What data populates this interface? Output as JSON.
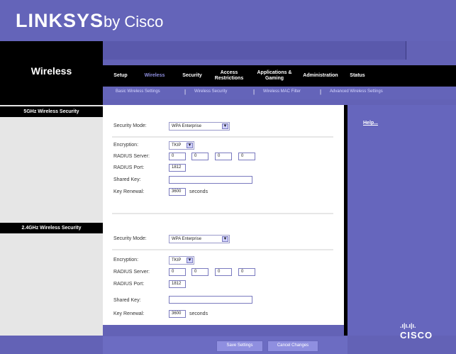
{
  "brand": {
    "name": "LINKSYS",
    "suffix": "by Cisco"
  },
  "page_title": "Wireless",
  "nav": {
    "tabs": [
      {
        "label": "Setup"
      },
      {
        "label": "Wireless"
      },
      {
        "label": "Security"
      },
      {
        "label": "Access Restrictions"
      },
      {
        "label": "Applications & Gaming"
      },
      {
        "label": "Administration"
      },
      {
        "label": "Status"
      }
    ]
  },
  "subnav": {
    "items": [
      {
        "label": "Basic Wireless Settings"
      },
      {
        "label": "Wireless Security"
      },
      {
        "label": "Wireless MAC Filter"
      },
      {
        "label": "Advanced Wireless Settings"
      }
    ]
  },
  "sections": [
    {
      "label": "5GHz Wireless Security",
      "security_mode_label": "Security Mode:",
      "security_mode": "WPA Enterprise",
      "encryption_label": "Encryption:",
      "encryption": "TKIP",
      "radius_server_label": "RADIUS Server:",
      "radius_server": [
        "0",
        "0",
        "0",
        "0"
      ],
      "radius_port_label": "RADIUS Port:",
      "radius_port": "1812",
      "shared_key_label": "Shared Key:",
      "shared_key": "",
      "key_renewal_label": "Key Renewal:",
      "key_renewal": "3600",
      "key_renewal_unit": "seconds"
    },
    {
      "label": "2.4GHz Wireless Security",
      "security_mode_label": "Security Mode:",
      "security_mode": "WPA Enterprise",
      "encryption_label": "Encryption:",
      "encryption": "TKIP",
      "radius_server_label": "RADIUS Server:",
      "radius_server": [
        "0",
        "0",
        "0",
        "0"
      ],
      "radius_port_label": "RADIUS Port:",
      "radius_port": "1812",
      "shared_key_label": "Shared Key:",
      "shared_key": "",
      "key_renewal_label": "Key Renewal:",
      "key_renewal": "3600",
      "key_renewal_unit": "seconds"
    }
  ],
  "help": {
    "label": "Help..."
  },
  "footer": {
    "save_label": "Save Settings",
    "cancel_label": "Cancel Changes"
  },
  "cisco": {
    "label": "CISCO"
  },
  "colors": {
    "brand_purple": "#6464b9",
    "accent": "#8f8fe0"
  }
}
